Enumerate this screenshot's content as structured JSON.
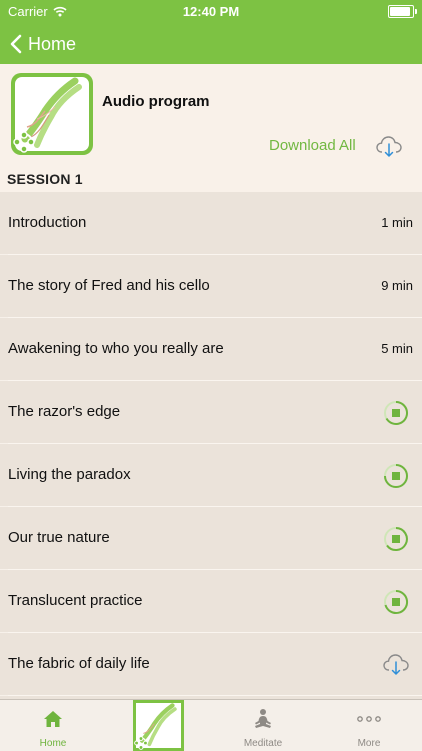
{
  "status_bar": {
    "carrier": "Carrier",
    "time": "12:40 PM"
  },
  "nav": {
    "back_label": "Home"
  },
  "program": {
    "title": "Audio program",
    "download_all_label": "Download All"
  },
  "section": {
    "title": "SESSION 1"
  },
  "tracks": [
    {
      "title": "Introduction",
      "duration": "1 min",
      "state": "downloaded"
    },
    {
      "title": "The story of Fred and his cello",
      "duration": "9 min",
      "state": "downloaded"
    },
    {
      "title": "Awakening to who you really are",
      "duration": "5 min",
      "state": "downloaded"
    },
    {
      "title": "The razor's edge",
      "duration": "",
      "state": "downloading",
      "icon": "stop-icon"
    },
    {
      "title": "Living the paradox",
      "duration": "",
      "state": "downloading",
      "icon": "stop-icon"
    },
    {
      "title": "Our true nature",
      "duration": "",
      "state": "downloading",
      "icon": "stop-icon"
    },
    {
      "title": "Translucent practice",
      "duration": "",
      "state": "downloading",
      "icon": "stop-icon"
    },
    {
      "title": "The fabric of daily life",
      "duration": "",
      "state": "not-downloaded",
      "icon": "cloud-download-icon"
    }
  ],
  "tabbar": {
    "home_label": "Home",
    "meditate_label": "Meditate",
    "more_label": "More"
  },
  "colors": {
    "accent": "#7dc243",
    "header_bg": "#f9f1e9",
    "list_bg": "#ebe3da"
  }
}
